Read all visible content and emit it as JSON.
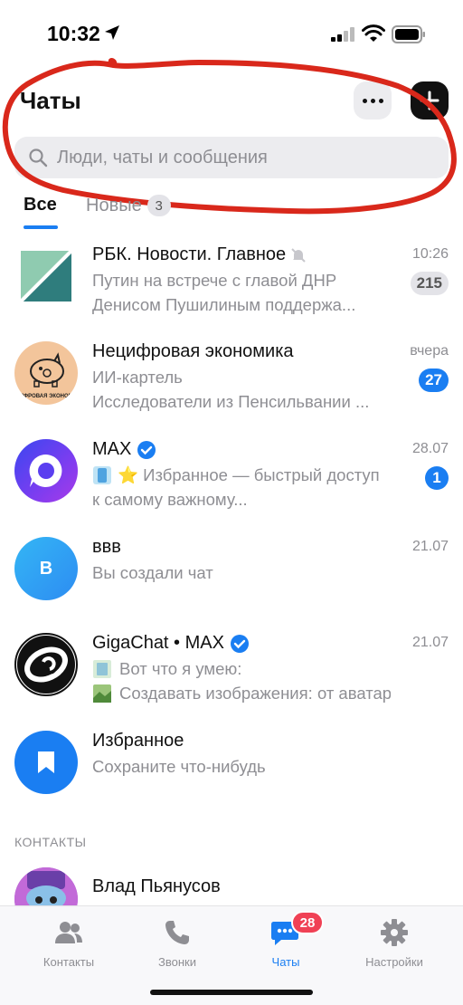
{
  "status_bar": {
    "time": "10:32"
  },
  "header": {
    "title": "Чаты",
    "more_icon": "more-dots-icon",
    "add_icon": "plus-icon"
  },
  "search": {
    "placeholder": "Люди, чаты и сообщения"
  },
  "filters": {
    "all_label": "Все",
    "new_label": "Новые",
    "new_count": "3"
  },
  "chats": [
    {
      "name": "РБК. Новости. Главное",
      "muted": true,
      "time": "10:26",
      "line1": "Путин на встрече с главой ДНР",
      "line2": "Денисом Пушилиным поддержа...",
      "badge": "215",
      "badge_style": "muted"
    },
    {
      "name": "Нецифровая экономика",
      "time": "вчера",
      "line1": "ИИ-картель",
      "line2": "Исследователи из Пенсильвании ...",
      "badge": "27",
      "badge_style": "blue",
      "avatar_text": "НЕЦИФРОВАЯ ЭКОНОМИКА"
    },
    {
      "name": "MAX",
      "verified": true,
      "time": "28.07",
      "line1": "⭐ Избранное — быстрый доступ",
      "line2": "к самому важному...",
      "badge": "1",
      "badge_style": "blue"
    },
    {
      "name": "ввв",
      "time": "21.07",
      "line1": "Вы создали чат",
      "avatar_letter": "В"
    },
    {
      "name": "GigaChat • MAX",
      "verified": true,
      "time": "21.07",
      "line1": "Вот что я умею:",
      "line2": "Создавать изображения: от аватар..."
    },
    {
      "name": "Избранное",
      "line1": "Сохраните что-нибудь"
    }
  ],
  "contacts_section": {
    "title": "КОНТАКТЫ",
    "first_contact": "Влад Пьянусов"
  },
  "tab_bar": {
    "items": [
      {
        "label": "Контакты",
        "icon": "contacts-icon"
      },
      {
        "label": "Звонки",
        "icon": "phone-icon"
      },
      {
        "label": "Чаты",
        "icon": "chat-bubble-icon",
        "count": "28",
        "active": true
      },
      {
        "label": "Настройки",
        "icon": "gear-icon"
      }
    ]
  },
  "colors": {
    "accent": "#1a7ef2",
    "badge_red": "#f04155",
    "annotation": "#d9281b"
  }
}
